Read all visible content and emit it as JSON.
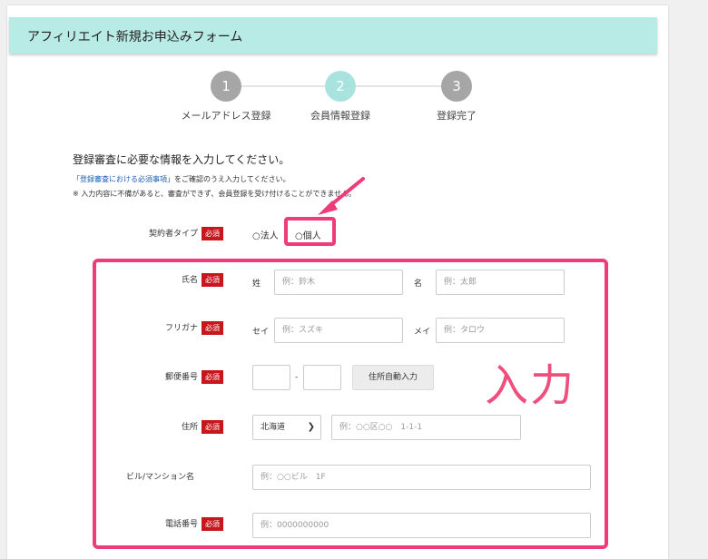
{
  "header": {
    "title": "アフィリエイト新規お申込みフォーム"
  },
  "steps": [
    {
      "num": "1",
      "label": "メールアドレス登録",
      "color": "#a6a6a6"
    },
    {
      "num": "2",
      "label": "会員情報登録",
      "color": "#a9e3df"
    },
    {
      "num": "3",
      "label": "登録完了",
      "color": "#a6a6a6"
    }
  ],
  "intro": "登録審査に必要な情報を入力してください。",
  "note1_link": "「登録審査における必須事項」",
  "note1_rest": "をご確認のうえ入力してください。",
  "note2": "※ 入力内容に不備があると、審査ができず、会員登録を受け付けることができません。",
  "required_badge": "必須",
  "contract_type": {
    "label": "契約者タイプ",
    "options": [
      "○法人",
      "○個人"
    ]
  },
  "form": {
    "name": {
      "label": "氏名",
      "last_label": "姓",
      "last_placeholder": "例：鈴木",
      "first_label": "名",
      "first_placeholder": "例：太郎"
    },
    "furigana": {
      "label": "フリガナ",
      "last_label": "セイ",
      "last_placeholder": "例：スズキ",
      "first_label": "メイ",
      "first_placeholder": "例：タロウ"
    },
    "postal": {
      "label": "郵便番号",
      "separator": "-",
      "button": "住所自動入力"
    },
    "address": {
      "label": "住所",
      "prefecture": "北海道",
      "placeholder": "例：○○区○○　1-1-1"
    },
    "building": {
      "label": "ビル/マンション名",
      "placeholder": "例：○○ビル　1F"
    },
    "phone": {
      "label": "電話番号",
      "placeholder": "例：0000000000"
    }
  },
  "annotation": {
    "text": "入力",
    "color": "#ef3b7a"
  }
}
